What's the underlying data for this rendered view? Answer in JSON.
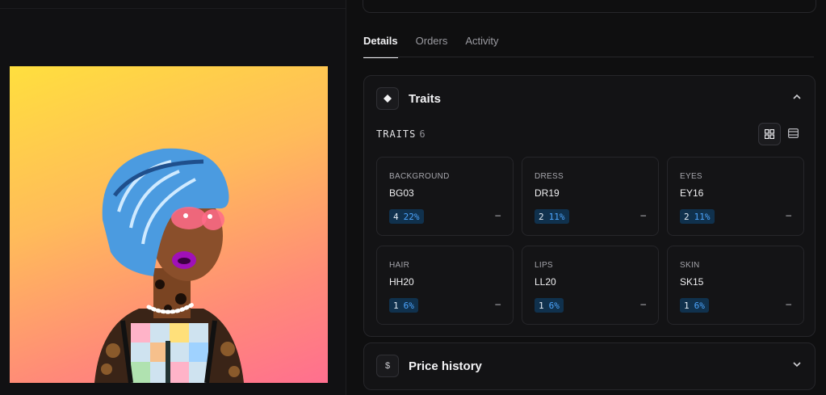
{
  "tabs": [
    {
      "label": "Details",
      "active": true
    },
    {
      "label": "Orders",
      "active": false
    },
    {
      "label": "Activity",
      "active": false
    }
  ],
  "traits_section": {
    "title": "Traits",
    "list_label": "TRAITS",
    "count": "6",
    "items": [
      {
        "type": "BACKGROUND",
        "value": "BG03",
        "count": "4",
        "percent": "22%",
        "price": "–"
      },
      {
        "type": "DRESS",
        "value": "DR19",
        "count": "2",
        "percent": "11%",
        "price": "–"
      },
      {
        "type": "EYES",
        "value": "EY16",
        "count": "2",
        "percent": "11%",
        "price": "–"
      },
      {
        "type": "HAIR",
        "value": "HH20",
        "count": "1",
        "percent": "6%",
        "price": "–"
      },
      {
        "type": "LIPS",
        "value": "LL20",
        "count": "1",
        "percent": "6%",
        "price": "–"
      },
      {
        "type": "SKIN",
        "value": "SK15",
        "count": "1",
        "percent": "6%",
        "price": "–"
      }
    ]
  },
  "price_history": {
    "title": "Price history",
    "icon_glyph": "$"
  },
  "icons": {
    "traits": "diamond-icon",
    "collapse": "chevron-up-icon",
    "expand": "chevron-down-icon",
    "grid_view": "grid-view-icon",
    "list_view": "list-view-icon",
    "price": "dollar-icon"
  },
  "colors": {
    "background": "#0f0f10",
    "card_border": "#26262a",
    "badge_bg": "#10314d",
    "badge_percent": "#4da6ff"
  }
}
